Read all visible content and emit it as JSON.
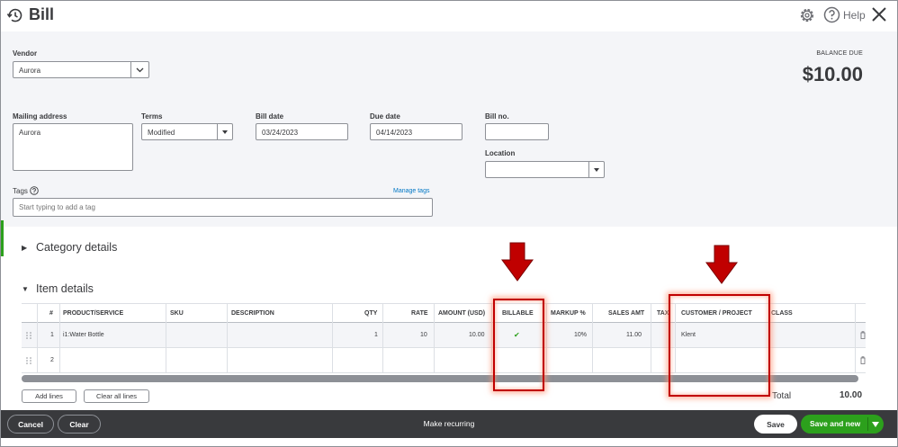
{
  "header": {
    "title": "Bill",
    "help_label": "Help",
    "icons": [
      "history-icon",
      "gear-icon",
      "help-icon",
      "close-icon"
    ]
  },
  "form": {
    "vendor_label": "Vendor",
    "vendor_value": "Aurora",
    "balance_label": "BALANCE DUE",
    "balance_value": "$10.00",
    "mailing_label": "Mailing address",
    "mailing_value": "Aurora",
    "terms_label": "Terms",
    "terms_value": "Modified",
    "bill_date_label": "Bill date",
    "bill_date_value": "03/24/2023",
    "due_date_label": "Due date",
    "due_date_value": "04/14/2023",
    "bill_no_label": "Bill no.",
    "bill_no_value": "",
    "location_label": "Location",
    "location_value": "",
    "tags_label": "Tags",
    "manage_tags": "Manage tags",
    "tags_placeholder": "Start typing to add a tag"
  },
  "sections": {
    "category": "Category details",
    "item": "Item details"
  },
  "item_table": {
    "headers": {
      "num": "#",
      "product": "PRODUCT/SERVICE",
      "sku": "SKU",
      "description": "DESCRIPTION",
      "qty": "QTY",
      "rate": "RATE",
      "amount": "AMOUNT (USD)",
      "billable": "BILLABLE",
      "markup": "MARKUP %",
      "sales_amt": "SALES AMT",
      "tax": "TAX",
      "customer": "CUSTOMER / PROJECT",
      "class": "CLASS"
    },
    "rows": [
      {
        "num": "1",
        "product": "i1:Water Bottle",
        "sku": "",
        "description": "",
        "qty": "1",
        "rate": "10",
        "amount": "10.00",
        "billable_mark": "✔",
        "markup": "10%",
        "sales_amt": "11.00",
        "customer": "Klent"
      },
      {
        "num": "2",
        "product": "",
        "sku": "",
        "description": "",
        "qty": "",
        "rate": "",
        "amount": "",
        "billable_mark": "",
        "markup": "",
        "sales_amt": "",
        "customer": ""
      }
    ],
    "add_lines": "Add lines",
    "clear_all_lines": "Clear all lines",
    "total_label": "Total",
    "total_value": "10.00"
  },
  "footer": {
    "cancel": "Cancel",
    "clear": "Clear",
    "make_recurring": "Make recurring",
    "save": "Save",
    "save_and_new": "Save and new"
  },
  "colors": {
    "brand_green": "#2ca01c",
    "footer_bg": "#393a3d",
    "annotation_red": "#c00000",
    "link_blue": "#0077c5"
  }
}
